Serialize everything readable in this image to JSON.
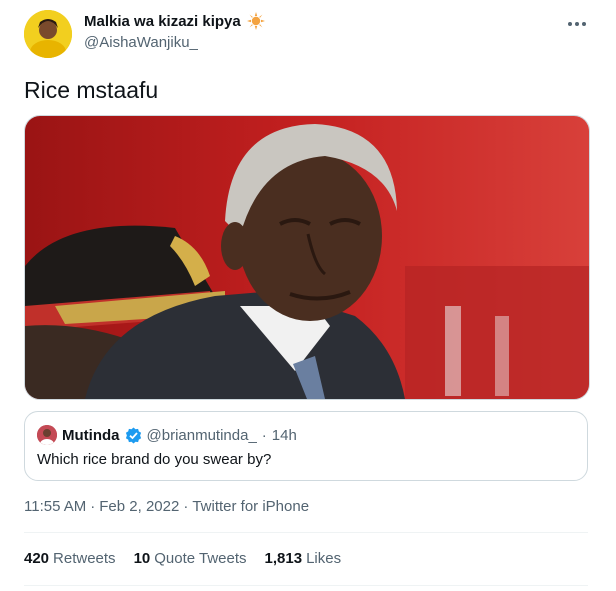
{
  "author": {
    "display_name": "Malkia wa kizazi kipya",
    "handle": "@AishaWanjiku_"
  },
  "tweet": {
    "text": "Rice mstaafu",
    "media_icon": "photo-of-elderly-man"
  },
  "quoted": {
    "name": "Mutinda",
    "handle": "@brianmutinda_",
    "separator": "·",
    "time": "14h",
    "text": "Which rice brand do you swear by?"
  },
  "meta": {
    "time": "11:55 AM",
    "sep1": "·",
    "date": "Feb 2, 2022",
    "sep2": "·",
    "source": "Twitter for iPhone"
  },
  "stats": {
    "retweets": {
      "count": "420",
      "label": "Retweets"
    },
    "quotes": {
      "count": "10",
      "label": "Quote Tweets"
    },
    "likes": {
      "count": "1,813",
      "label": "Likes"
    }
  },
  "colors": {
    "text": "#0f1419",
    "secondary": "#536471",
    "border": "#cfd9de",
    "verified": "#1d9bf0",
    "badge": "#f4a340"
  }
}
